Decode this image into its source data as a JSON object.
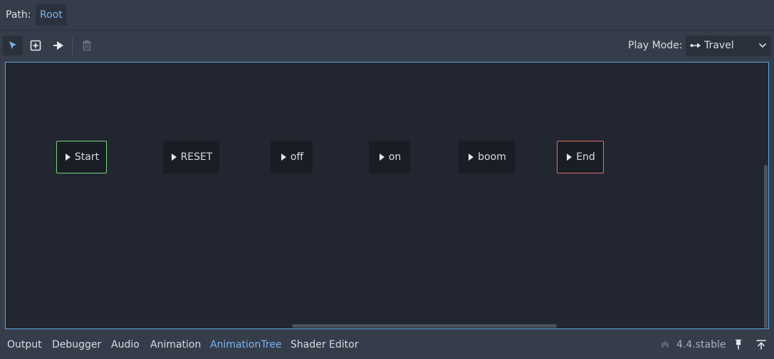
{
  "path_bar": {
    "label": "Path:",
    "crumb": "Root"
  },
  "toolbar": {
    "tools": [
      "select-icon",
      "add-node-icon",
      "connect-transition-icon",
      "delete-icon"
    ],
    "play_mode_label": "Play Mode:",
    "play_mode_value": "Travel",
    "play_mode_icon": "travel-icon"
  },
  "graph": {
    "nodes": [
      {
        "label": "Start",
        "kind": "start",
        "border_color": "#7fcf7f"
      },
      {
        "label": "RESET",
        "kind": "normal"
      },
      {
        "label": "off",
        "kind": "normal"
      },
      {
        "label": "on",
        "kind": "normal"
      },
      {
        "label": "boom",
        "kind": "normal"
      },
      {
        "label": "End",
        "kind": "end",
        "border_color": "#e86b6b"
      }
    ]
  },
  "bottom_panel": {
    "tabs": [
      "Output",
      "Debugger",
      "Audio",
      "Animation",
      "AnimationTree",
      "Shader Editor"
    ],
    "active_tab": "AnimationTree",
    "version": "4.4.stable"
  },
  "colors": {
    "accent": "#7bb3ef",
    "graph_background": "#212630",
    "node_background": "#191d24",
    "panel_background": "#363d4a"
  }
}
